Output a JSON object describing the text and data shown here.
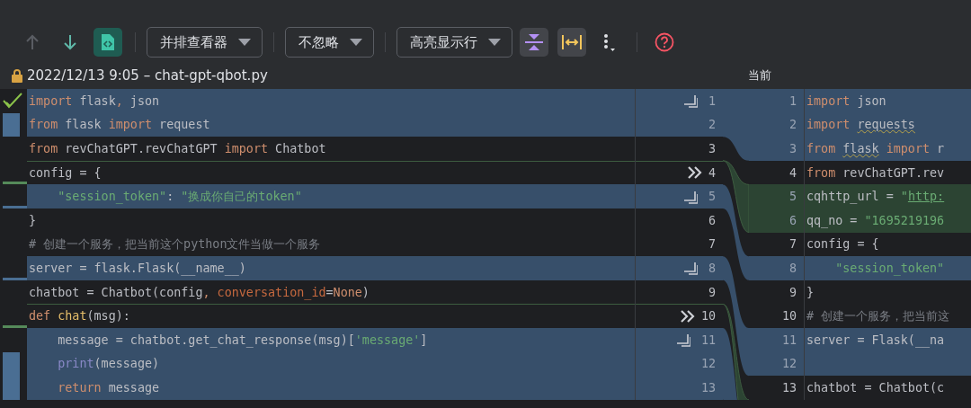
{
  "toolbar": {
    "nav": [
      {
        "kind": "up",
        "disabled": true
      },
      {
        "kind": "down",
        "disabled": false
      },
      {
        "kind": "file",
        "disabled": false
      }
    ],
    "dropdowns": [
      {
        "label": "并排查看器"
      },
      {
        "label": "不忽略"
      },
      {
        "label": "高亮显示行"
      }
    ],
    "toggles": [
      {
        "kind": "collapse",
        "on": true
      },
      {
        "kind": "sync",
        "on": true
      }
    ]
  },
  "header": {
    "left_title": "2022/12/13 9:05 – chat-gpt-qbot.py",
    "right_title": "当前"
  },
  "left_lines": [
    {
      "number": "1",
      "kind": "changed",
      "marker": {
        "kind": "check"
      },
      "action": {
        "kind": "apply"
      },
      "tokens": [
        {
          "text": "import",
          "kind": "keyword"
        },
        {
          "text": " flask",
          "kind": "name"
        },
        {
          "text": ",",
          "kind": "keyword"
        },
        {
          "text": " json",
          "kind": "name"
        }
      ]
    },
    {
      "number": "2",
      "kind": "changed",
      "marker": {
        "kind": "bar"
      },
      "tokens": [
        {
          "text": "from",
          "kind": "keyword"
        },
        {
          "text": " flask ",
          "kind": "name"
        },
        {
          "text": "import",
          "kind": "keyword"
        },
        {
          "text": " request",
          "kind": "name"
        }
      ]
    },
    {
      "number": "3",
      "kind": "plain",
      "tokens": [
        {
          "text": "from",
          "kind": "keyword"
        },
        {
          "text": " revChatGPT.revChatGPT ",
          "kind": "name"
        },
        {
          "text": "import",
          "kind": "keyword"
        },
        {
          "text": " Chatbot",
          "kind": "name"
        }
      ]
    },
    {
      "number": "4",
      "kind": "plain",
      "marker": {
        "kind": "added"
      },
      "action": {
        "kind": "insert"
      },
      "tokens": [
        {
          "text": "config = {",
          "kind": "name"
        }
      ]
    },
    {
      "number": "5",
      "kind": "changed",
      "marker": {
        "kind": "changed"
      },
      "action": {
        "kind": "apply"
      },
      "tokens": [
        {
          "text": "    \"session_token\"",
          "kind": "string"
        },
        {
          "text": ": ",
          "kind": "name"
        },
        {
          "text": "\"换成你自己的token\"",
          "kind": "string"
        }
      ]
    },
    {
      "number": "6",
      "kind": "plain",
      "tokens": [
        {
          "text": "}",
          "kind": "name"
        }
      ]
    },
    {
      "number": "7",
      "kind": "plain",
      "tokens": [
        {
          "text": "# 创建一个服务，把当前这个python文件当做一个服务",
          "kind": "comment"
        }
      ]
    },
    {
      "number": "8",
      "kind": "changed",
      "marker": {
        "kind": "changed"
      },
      "action": {
        "kind": "apply"
      },
      "tokens": [
        {
          "text": "server = flask.Flask(__name__)",
          "kind": "name"
        }
      ]
    },
    {
      "number": "9",
      "kind": "plain",
      "tokens": [
        {
          "text": "chatbot = Chatbot(config",
          "kind": "name"
        },
        {
          "text": ", ",
          "kind": "keyword"
        },
        {
          "text": "conversation_id",
          "kind": "param"
        },
        {
          "text": "=",
          "kind": "name"
        },
        {
          "text": "None",
          "kind": "keyword"
        },
        {
          "text": ")",
          "kind": "name"
        }
      ]
    },
    {
      "number": "10",
      "kind": "plain",
      "marker": {
        "kind": "added"
      },
      "action": {
        "kind": "insert"
      },
      "tokens": [
        {
          "text": "def ",
          "kind": "keyword"
        },
        {
          "text": "chat",
          "kind": "function"
        },
        {
          "text": "(msg):",
          "kind": "name"
        }
      ]
    },
    {
      "number": "11",
      "kind": "changed",
      "action": {
        "kind": "apply"
      },
      "tokens": [
        {
          "text": "    message = chatbot.get_chat_response(msg)[",
          "kind": "name"
        },
        {
          "text": "'message'",
          "kind": "string"
        },
        {
          "text": "]",
          "kind": "name"
        }
      ]
    },
    {
      "number": "12",
      "kind": "changed",
      "marker": {
        "kind": "bar"
      },
      "tokens": [
        {
          "text": "    print",
          "kind": "builtin"
        },
        {
          "text": "(message)",
          "kind": "name"
        }
      ]
    },
    {
      "number": "13",
      "kind": "changed",
      "marker": {
        "kind": "bar"
      },
      "tokens": [
        {
          "text": "    return",
          "kind": "keyword"
        },
        {
          "text": " message",
          "kind": "name"
        }
      ]
    }
  ],
  "right_lines": [
    {
      "number": "1",
      "kind": "changed",
      "tokens": [
        {
          "text": "import",
          "kind": "keyword"
        },
        {
          "text": " json",
          "kind": "name"
        }
      ]
    },
    {
      "number": "2",
      "kind": "changed",
      "tokens": [
        {
          "text": "import ",
          "kind": "keyword"
        },
        {
          "text": "requests",
          "kind": "warning"
        }
      ]
    },
    {
      "number": "3",
      "kind": "changed",
      "tokens": [
        {
          "text": "from ",
          "kind": "keyword"
        },
        {
          "text": "flask",
          "kind": "warning"
        },
        {
          "text": " import",
          "kind": "keyword"
        },
        {
          "text": " r",
          "kind": "name"
        }
      ]
    },
    {
      "number": "4",
      "kind": "plain",
      "tokens": [
        {
          "text": "from",
          "kind": "keyword"
        },
        {
          "text": " revChatGPT.rev",
          "kind": "name"
        }
      ]
    },
    {
      "number": "5",
      "kind": "inserted",
      "tokens": [
        {
          "text": "cqhttp_url = ",
          "kind": "name"
        },
        {
          "text": "\"",
          "kind": "string"
        },
        {
          "text": "http:",
          "kind": "link"
        }
      ]
    },
    {
      "number": "6",
      "kind": "inserted",
      "tokens": [
        {
          "text": "qq_no = ",
          "kind": "name"
        },
        {
          "text": "\"1695219196",
          "kind": "string"
        }
      ]
    },
    {
      "number": "7",
      "kind": "plain",
      "tokens": [
        {
          "text": "config = {",
          "kind": "name"
        }
      ]
    },
    {
      "number": "8",
      "kind": "changed",
      "tokens": [
        {
          "text": "    \"session_token\"",
          "kind": "string"
        }
      ]
    },
    {
      "number": "9",
      "kind": "plain",
      "tokens": [
        {
          "text": "}",
          "kind": "name"
        }
      ]
    },
    {
      "number": "10",
      "kind": "plain",
      "tokens": [
        {
          "text": "# 创建一个服务，把当前这",
          "kind": "comment"
        }
      ]
    },
    {
      "number": "11",
      "kind": "changed",
      "tokens": [
        {
          "text": "server = Flask(__na",
          "kind": "name"
        }
      ]
    },
    {
      "number": "12",
      "kind": "changed"
    },
    {
      "number": "13",
      "kind": "plain",
      "tokens": [
        {
          "text": "chatbot = Chatbot(c",
          "kind": "name"
        }
      ]
    }
  ]
}
